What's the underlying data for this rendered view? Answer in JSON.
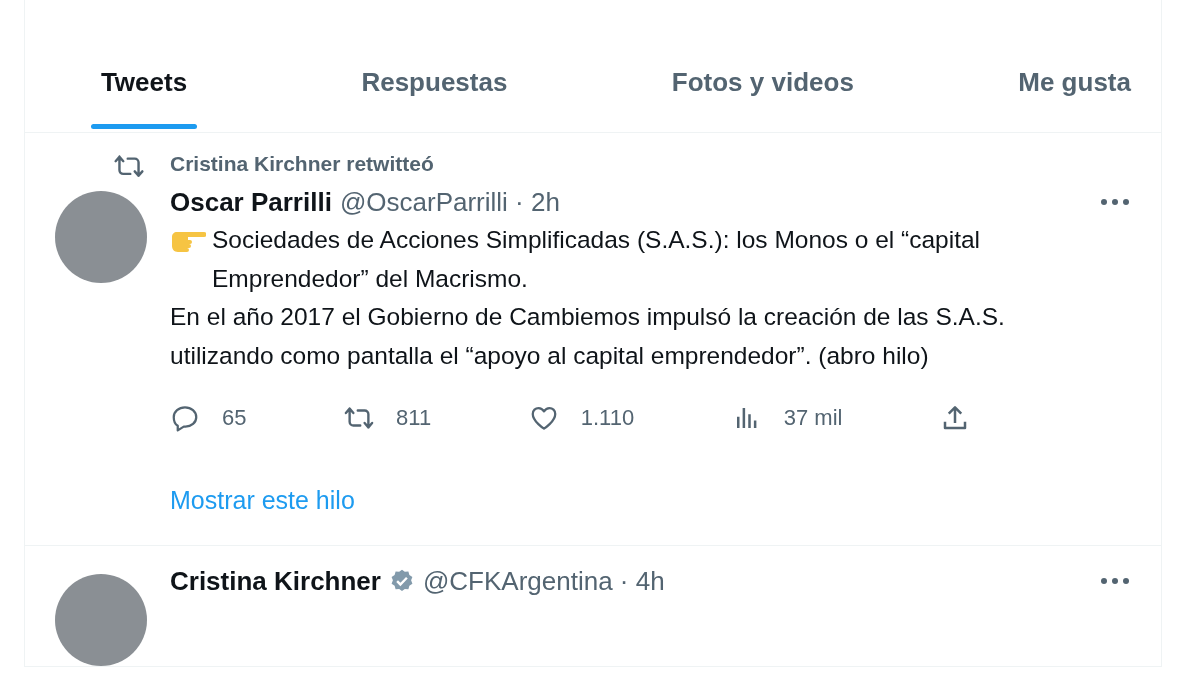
{
  "tabs": [
    {
      "label": "Tweets",
      "selected": true
    },
    {
      "label": "Respuestas",
      "selected": false
    },
    {
      "label": "Fotos y videos",
      "selected": false
    },
    {
      "label": "Me gusta",
      "selected": false
    }
  ],
  "tweets": [
    {
      "retweeted_by": "Cristina Kirchner retwitteó",
      "name": "Oscar Parrilli",
      "verified": false,
      "meta": "@OscarParrilli · 2h",
      "body": [
        "Sociedades de Acciones Simplificadas (S.A.S.): los Monos o el “capital Emprendedor” del Macrismo.",
        "En el año 2017 el Gobierno de Cambiemos impulsó la creación de las S.A.S. utilizando como pantalla el “apoyo al capital emprendedor”. (abro hilo)"
      ],
      "actions": [
        {
          "kind": "reply",
          "count": "65"
        },
        {
          "kind": "retweet",
          "count": "811"
        },
        {
          "kind": "like",
          "count": "1.110"
        },
        {
          "kind": "views",
          "count": "37 mil"
        },
        {
          "kind": "share"
        }
      ],
      "show_thread": "Mostrar este hilo"
    },
    {
      "name": "Cristina Kirchner",
      "verified": true,
      "meta": "@CFKArgentina · 4h"
    }
  ]
}
